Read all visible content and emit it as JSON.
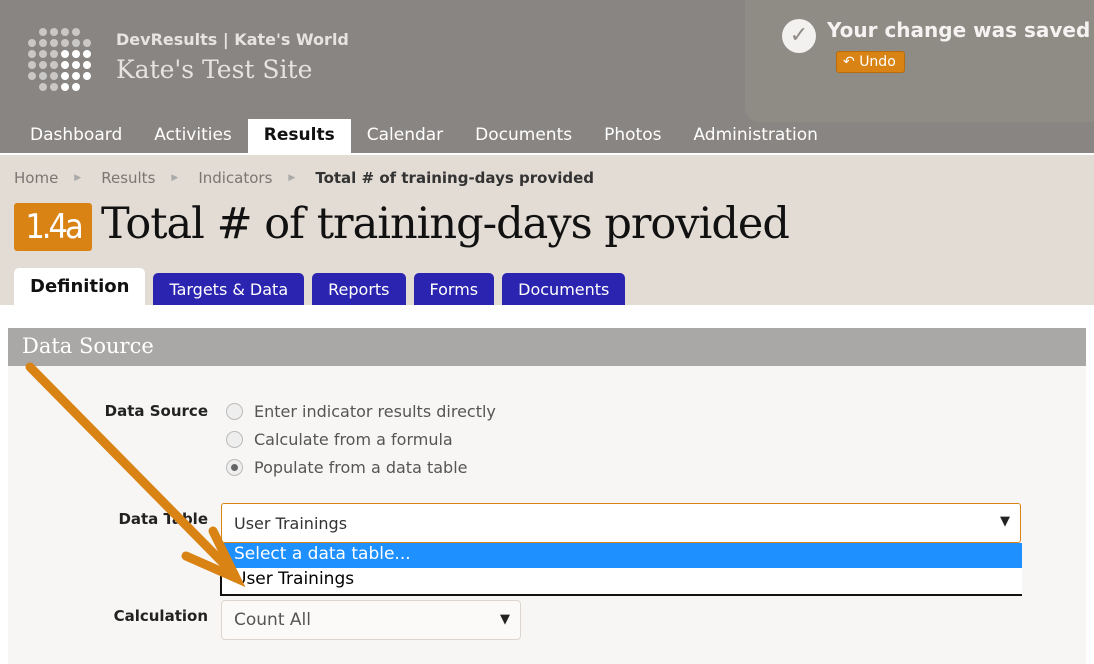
{
  "header": {
    "org": "DevResults | Kate's World",
    "site": "Kate's Test Site"
  },
  "toast": {
    "message": "Your change was saved",
    "undo_label": "Undo"
  },
  "nav": [
    {
      "label": "Dashboard"
    },
    {
      "label": "Activities"
    },
    {
      "label": "Results",
      "active": true
    },
    {
      "label": "Calendar"
    },
    {
      "label": "Documents"
    },
    {
      "label": "Photos"
    },
    {
      "label": "Administration"
    }
  ],
  "breadcrumb": [
    "Home",
    "Results",
    "Indicators",
    "Total # of training-days provided"
  ],
  "indicator": {
    "code": "1.4a",
    "title": "Total # of training-days provided"
  },
  "tabs": [
    {
      "label": "Definition",
      "active": true
    },
    {
      "label": "Targets & Data"
    },
    {
      "label": "Reports"
    },
    {
      "label": "Forms"
    },
    {
      "label": "Documents"
    }
  ],
  "panel": {
    "title": "Data Source",
    "data_source_label": "Data Source",
    "options": [
      "Enter indicator results directly",
      "Calculate from a formula",
      "Populate from a data table"
    ],
    "selected_option": 2,
    "data_table_label": "Data Table",
    "data_table_value": "User Trainings",
    "data_table_options": [
      "Select a data table...",
      "User Trainings"
    ],
    "calculation_label": "Calculation",
    "calculation_value": "Count All"
  },
  "colors": {
    "accent": "#d98314",
    "tab_blue": "#2b24b0",
    "highlight": "#1e90ff"
  }
}
